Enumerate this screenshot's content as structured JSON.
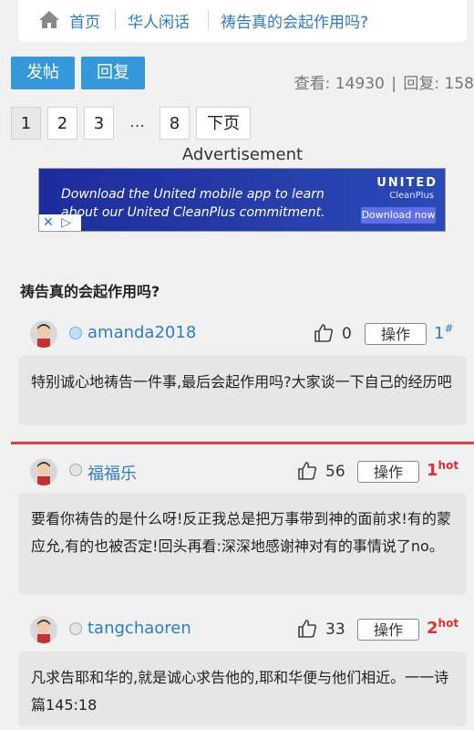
{
  "breadcrumb": {
    "items": [
      "首页",
      "华人闲话",
      "祷告真的会起作用吗?"
    ]
  },
  "actions": {
    "post_label": "发帖",
    "reply_label": "回复"
  },
  "stats": {
    "views_label": "查看:",
    "views": "14930",
    "sep": "|",
    "replies_label": "回复:",
    "replies": "158"
  },
  "pagination": {
    "pages": [
      "1",
      "2",
      "3",
      "…",
      "8"
    ],
    "next_label": "下页",
    "current": "1"
  },
  "ad": {
    "label": "Advertisement",
    "headline": "Download the United mobile app to learn about our United CleanPlus commitment.",
    "brand": "UNITED",
    "sub": "CleanPlus",
    "cta": "Download now"
  },
  "thread": {
    "title": "祷告真的会起作用吗?"
  },
  "posts": [
    {
      "username": "amanda2018",
      "likes": "0",
      "op_label": "操作",
      "floor": "1",
      "floor_suffix": "#",
      "content": "特别诚心地祷告一件事,最后会起作用吗?大家谈一下自己的经历吧"
    },
    {
      "username": "福福乐",
      "likes": "56",
      "op_label": "操作",
      "floor": "1",
      "floor_suffix": "hot",
      "content": "要看你祷告的是什么呀!反正我总是把万事带到神的面前求!有的蒙应允,有的也被否定!回头再看:深深地感谢神对有的事情说了no。"
    },
    {
      "username": "tangchaoren",
      "likes": "33",
      "op_label": "操作",
      "floor": "2",
      "floor_suffix": "hot",
      "content": "凡求告耶和华的,就是诚心求告他的,耶和华便与他们相近。一一诗篇145:18"
    }
  ],
  "colors": {
    "link": "#2e7dc4",
    "button": "#3498db",
    "hot": "#e03030",
    "floor_plain": "#2e7dc4"
  }
}
